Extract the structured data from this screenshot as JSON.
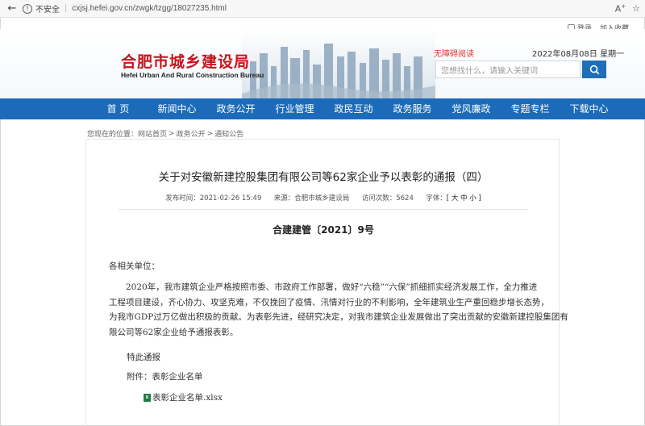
{
  "browser": {
    "back_icon": "back-arrow-icon",
    "security_label": "不安全",
    "url": "cxjsj.hefei.gov.cn/zwgk/tzgg/18027235.html",
    "read_aloud_icon": "read-aloud-icon",
    "favorite_icon": "star-icon"
  },
  "toplinks": {
    "login": "登录",
    "bookmark": "加入收藏"
  },
  "header": {
    "logo_cn": "合肥市城乡建设局",
    "logo_en": "Hefei Urban And Rural Construction Bureau",
    "barrier_free": "无障碍阅读",
    "date": "2022年08月08日 星期一",
    "search_placeholder": "您想找什么，请输入关键词"
  },
  "nav": [
    "首 页",
    "新闻中心",
    "政务公开",
    "行业管理",
    "政民互动",
    "政务服务",
    "党风廉政",
    "专题专栏",
    "下载中心"
  ],
  "breadcrumb": {
    "prefix": "您现在的位置：",
    "items": [
      "网站首页",
      "政务公开",
      "通知公告"
    ],
    "sep": ">"
  },
  "article": {
    "title": "关于对安徽新建控股集团有限公司等62家企业予以表彰的通报（四）",
    "meta": {
      "publish_label": "发布时间：",
      "publish_time": "2021-02-26 15:49",
      "source_label": "来源：",
      "source": "合肥市城乡建设局",
      "views_label": "访问次数：",
      "views": "5624",
      "font_label": "字体：",
      "font_controls": "[ 大 中 小 ]"
    },
    "doc_number": "合建建管〔2021〕9号",
    "salutation": "各相关单位：",
    "paragraph_lines": [
      "2020年，我市建筑企业严格按照市委、市政府工作部署，做好“六稳”“六保”抓细抓实经济发展工作，全力推进",
      "工程项目建设，齐心协力、攻坚克难，不仅挽回了疫情、汛情对行业的不利影响，全年建筑业生产重回稳步增长态势，",
      "为我市GDP过万亿做出积极的贡献。为表彰先进，经研究决定，对我市建筑企业发展做出了突出贡献的安徽新建控股集团有",
      "限公司等62家企业给予通报表彰。"
    ],
    "special_notice": "特此通报",
    "attachment_label": "附件：表彰企业名单",
    "attachment_file": "表彰企业名单.xlsx"
  },
  "colors": {
    "brand_red": "#c4161c",
    "nav_blue": "#1b6bba",
    "search_blue": "#1f6fb8",
    "excel_green": "#1e7b45"
  }
}
